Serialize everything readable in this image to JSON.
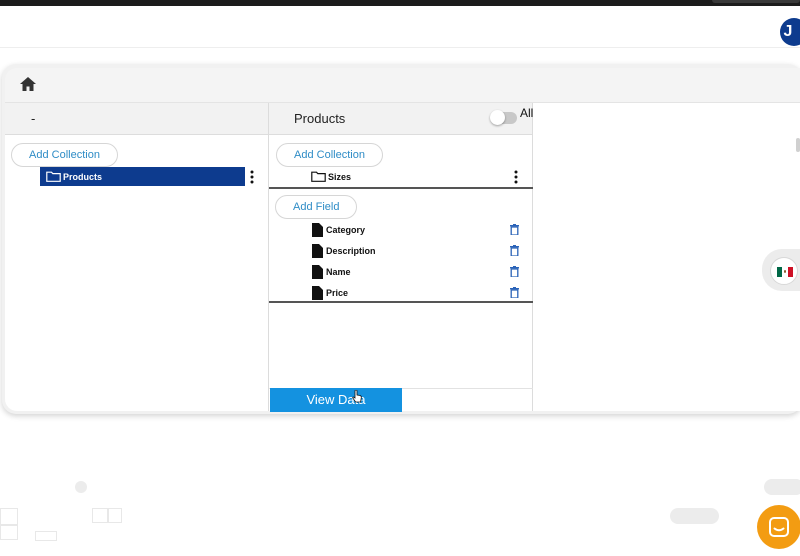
{
  "header": {
    "avatar_initial": "J"
  },
  "breadcrumb": {
    "home_icon": "home-icon"
  },
  "column_left": {
    "title": "-",
    "add_collection_label": "Add Collection",
    "items": [
      {
        "label": "Products",
        "icon": "folder-icon",
        "selected": true
      }
    ]
  },
  "column_middle": {
    "title": "Products",
    "toggle_label": "All",
    "toggle_on": false,
    "add_collection_label": "Add Collection",
    "collections": [
      {
        "label": "Sizes",
        "icon": "folder-icon"
      }
    ],
    "add_field_label": "Add Field",
    "fields": [
      {
        "label": "Category",
        "icon": "document-icon"
      },
      {
        "label": "Description",
        "icon": "document-icon"
      },
      {
        "label": "Name",
        "icon": "document-icon"
      },
      {
        "label": "Price",
        "icon": "document-icon"
      }
    ],
    "view_data_label": "View Data"
  },
  "language": {
    "flag": "mexico-flag-icon"
  },
  "colors": {
    "selected_bg": "#0d3b8e",
    "accent_text": "#2e8cc6",
    "primary_button": "#1492e0",
    "avatar_bg": "#0d3b8e",
    "chat_fab": "#f39c12",
    "trash_icon": "#2a63b8"
  }
}
